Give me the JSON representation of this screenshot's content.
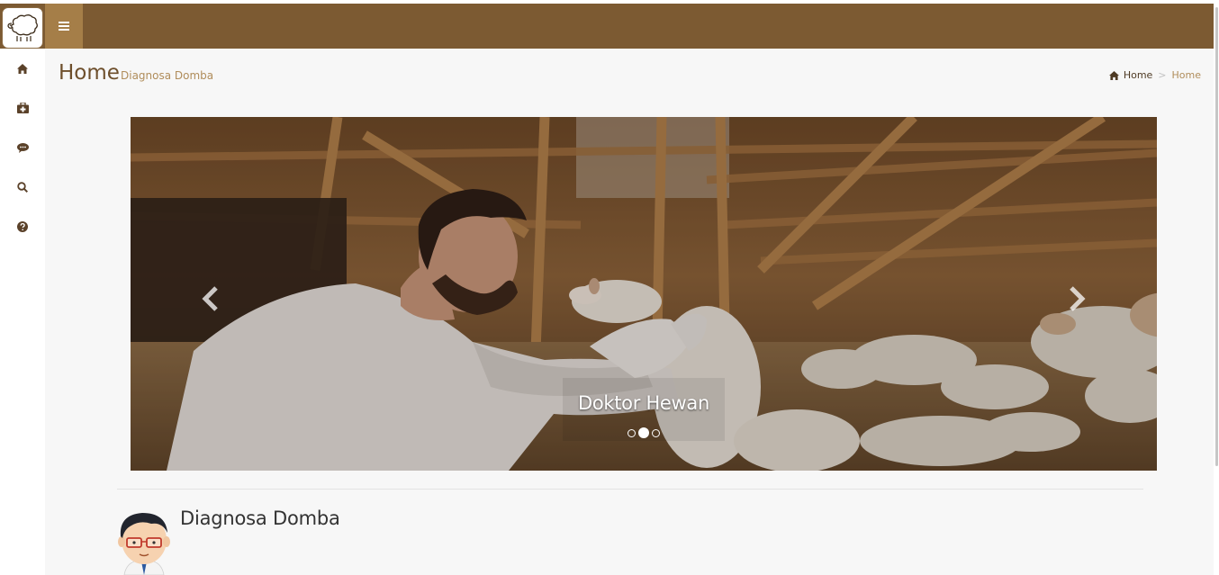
{
  "colors": {
    "header": "#7c5a32",
    "menu_toggle": "#a57e48",
    "title": "#6e4f2c",
    "subtitle": "#b08d5b",
    "sidebar_icon": "#5a4129"
  },
  "header": {
    "logo_icon": "sheep-icon",
    "menu_icon": "hamburger-icon"
  },
  "sidebar": {
    "items": [
      {
        "icon": "home-icon"
      },
      {
        "icon": "medical-kit-icon"
      },
      {
        "icon": "comment-icon"
      },
      {
        "icon": "search-icon"
      },
      {
        "icon": "question-circle-icon"
      }
    ]
  },
  "page": {
    "title": "Home",
    "subtitle": "Diagnosa Domba"
  },
  "breadcrumb": {
    "home_label": "Home",
    "separator": ">",
    "current": "Home"
  },
  "carousel": {
    "caption": "Doktor Hewan",
    "slide_count": 3,
    "active_index": 1
  },
  "section": {
    "title": "Diagnosa Domba",
    "avatar_icon": "doctor-avatar-icon"
  }
}
